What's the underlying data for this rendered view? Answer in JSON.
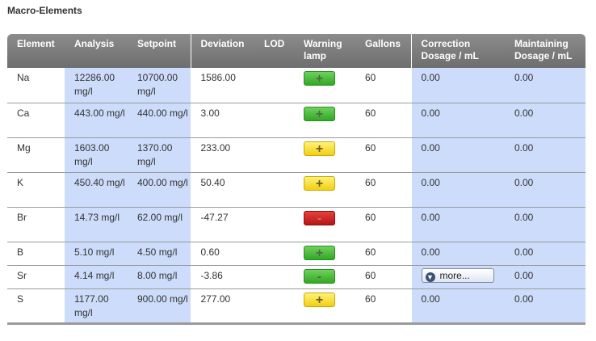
{
  "section": {
    "title": "Macro-Elements"
  },
  "table": {
    "headers": {
      "element": "Element",
      "analysis": "Analysis",
      "setpoint": "Setpoint",
      "deviation": "Deviation",
      "lod": "LOD",
      "warning": "Warning lamp",
      "gallons": "Gallons",
      "correction": "Correction Dosage / mL",
      "maintaining": "Maintaining Dosage / mL"
    },
    "rows": [
      {
        "element": "Na",
        "analysis": "12286.00 mg/l",
        "setpoint": "10700.00 mg/l",
        "deviation": "1586.00",
        "lod": "",
        "lamp_symbol": "+",
        "lamp_color": "green",
        "gallons": "60",
        "correction": "0.00",
        "maintaining": "0.00"
      },
      {
        "element": "Ca",
        "analysis": "443.00 mg/l",
        "setpoint": "440.00 mg/l",
        "deviation": "3.00",
        "lod": "",
        "lamp_symbol": "+",
        "lamp_color": "green",
        "gallons": "60",
        "correction": "0.00",
        "maintaining": "0.00"
      },
      {
        "element": "Mg",
        "analysis": "1603.00 mg/l",
        "setpoint": "1370.00 mg/l",
        "deviation": "233.00",
        "lod": "",
        "lamp_symbol": "+",
        "lamp_color": "yellow",
        "gallons": "60",
        "correction": "0.00",
        "maintaining": "0.00"
      },
      {
        "element": "K",
        "analysis": "450.40 mg/l",
        "setpoint": "400.00 mg/l",
        "deviation": "50.40",
        "lod": "",
        "lamp_symbol": "+",
        "lamp_color": "yellow",
        "gallons": "60",
        "correction": "0.00",
        "maintaining": "0.00"
      },
      {
        "element": "Br",
        "analysis": "14.73 mg/l",
        "setpoint": "62.00 mg/l",
        "deviation": "-47.27",
        "lod": "",
        "lamp_symbol": "-",
        "lamp_color": "red",
        "gallons": "60",
        "correction": "0.00",
        "maintaining": "0.00"
      },
      {
        "element": "B",
        "analysis": "5.10 mg/l",
        "setpoint": "4.50 mg/l",
        "deviation": "0.60",
        "lod": "",
        "lamp_symbol": "+",
        "lamp_color": "green",
        "gallons": "60",
        "correction": "0.00",
        "maintaining": "0.00"
      },
      {
        "element": "Sr",
        "analysis": "4.14 mg/l",
        "setpoint": "8.00 mg/l",
        "deviation": "-3.86",
        "lod": "",
        "lamp_symbol": "-",
        "lamp_color": "green",
        "gallons": "60",
        "correction_button": "more...",
        "maintaining": "0.00"
      },
      {
        "element": "S",
        "analysis": "1177.00 mg/l",
        "setpoint": "900.00 mg/l",
        "deviation": "277.00",
        "lod": "",
        "lamp_symbol": "+",
        "lamp_color": "yellow",
        "gallons": "60",
        "correction": "0.00",
        "maintaining": "0.00"
      }
    ]
  },
  "colors": {
    "header_bg": "#7d7d7d",
    "highlight_col": "#cddcfa",
    "lamp_green": "#3cb52c",
    "lamp_yellow": "#f7db2a",
    "lamp_red": "#c62222"
  },
  "icons": {
    "more_button_icon": "arrow-down-circle-icon"
  }
}
